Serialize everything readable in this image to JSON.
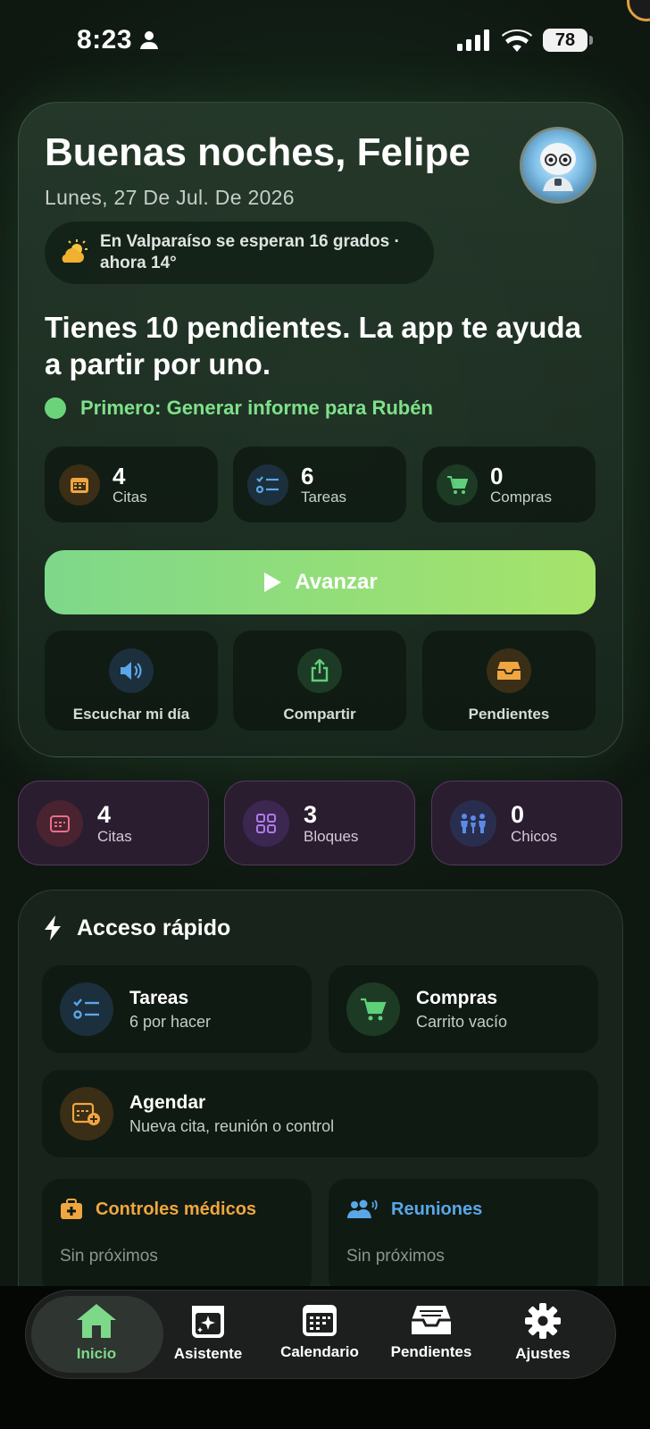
{
  "status_bar": {
    "time": "8:23",
    "battery": "78"
  },
  "hero": {
    "greeting": "Buenas noches, Felipe",
    "date": "Lunes, 27 De Jul. De 2026",
    "weather_line1": "En Valparaíso se esperan 16 grados ·",
    "weather_line2": "ahora 14°",
    "headline": "Tienes 10 pendientes. La app te ayuda a partir por uno.",
    "first_task": "Primero: Generar informe para Rubén",
    "stats": [
      {
        "value": "4",
        "label": "Citas",
        "icon": "calendar-icon"
      },
      {
        "value": "6",
        "label": "Tareas",
        "icon": "checklist-icon"
      },
      {
        "value": "0",
        "label": "Compras",
        "icon": "cart-icon"
      }
    ],
    "cta_label": "Avanzar",
    "actions": [
      {
        "label": "Escuchar mi día",
        "icon": "speaker-icon"
      },
      {
        "label": "Compartir",
        "icon": "share-icon"
      },
      {
        "label": "Pendientes",
        "icon": "inbox-icon"
      }
    ]
  },
  "summary": [
    {
      "value": "4",
      "label": "Citas",
      "icon": "calendar-icon"
    },
    {
      "value": "3",
      "label": "Bloques",
      "icon": "grid-icon"
    },
    {
      "value": "0",
      "label": "Chicos",
      "icon": "family-icon"
    }
  ],
  "quick_access": {
    "title": "Acceso rápido",
    "tareas": {
      "title": "Tareas",
      "subtitle": "6 por hacer"
    },
    "compras": {
      "title": "Compras",
      "subtitle": "Carrito vacío"
    },
    "agendar": {
      "title": "Agendar",
      "subtitle": "Nueva cita, reunión o control"
    },
    "controles": {
      "title": "Controles médicos",
      "subtitle": "Sin próximos"
    },
    "reuniones": {
      "title": "Reuniones",
      "subtitle": "Sin próximos"
    }
  },
  "nav": [
    {
      "label": "Inicio",
      "icon": "home-icon",
      "active": true
    },
    {
      "label": "Asistente",
      "icon": "assistant-icon"
    },
    {
      "label": "Calendario",
      "icon": "calendar-icon"
    },
    {
      "label": "Pendientes",
      "icon": "inbox-icon"
    },
    {
      "label": "Ajustes",
      "icon": "gear-icon"
    }
  ],
  "colors": {
    "accent_green": "#7ed88a",
    "orange": "#f0a640",
    "blue": "#5aa7e8",
    "purple_card": "#2a1d30"
  }
}
